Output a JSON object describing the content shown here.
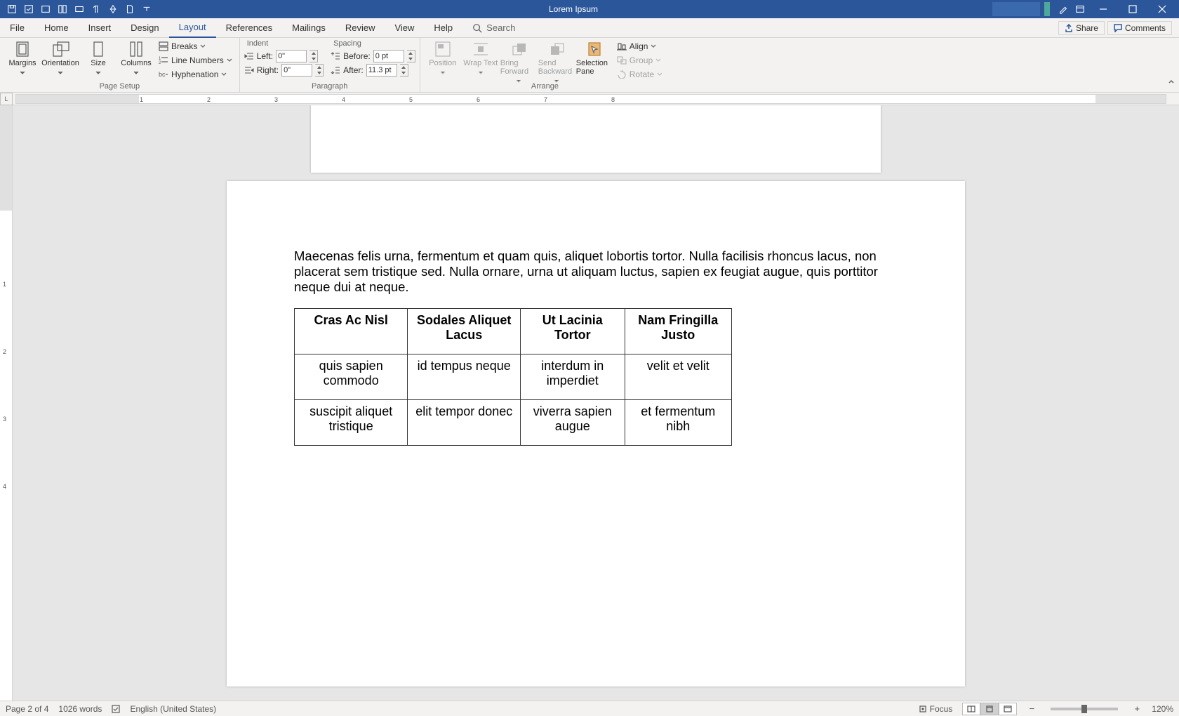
{
  "title": "Lorem Ipsum",
  "tabs": [
    "File",
    "Home",
    "Insert",
    "Design",
    "Layout",
    "References",
    "Mailings",
    "Review",
    "View",
    "Help"
  ],
  "active_tab": "Layout",
  "search_placeholder": "Search",
  "share_label": "Share",
  "comments_label": "Comments",
  "ribbon": {
    "page_setup": {
      "margins": "Margins",
      "orientation": "Orientation",
      "size": "Size",
      "columns": "Columns",
      "breaks": "Breaks",
      "line_numbers": "Line Numbers",
      "hyphenation": "Hyphenation",
      "label": "Page Setup"
    },
    "paragraph": {
      "indent_hdr": "Indent",
      "spacing_hdr": "Spacing",
      "left_label": "Left:",
      "right_label": "Right:",
      "before_label": "Before:",
      "after_label": "After:",
      "left_val": "0\"",
      "right_val": "0\"",
      "before_val": "0 pt",
      "after_val": "11.3 pt",
      "label": "Paragraph"
    },
    "arrange": {
      "position": "Position",
      "wrap_text": "Wrap Text",
      "bring_forward": "Bring Forward",
      "send_backward": "Send Backward",
      "selection_pane": "Selection Pane",
      "align": "Align",
      "group": "Group",
      "rotate": "Rotate",
      "label": "Arrange"
    }
  },
  "ruler_corner": "L",
  "ruler_marks": [
    "1",
    "2",
    "3",
    "4",
    "5",
    "6",
    "7",
    "8"
  ],
  "vruler_marks": [
    "1",
    "2",
    "3",
    "4"
  ],
  "document": {
    "paragraph": "Maecenas felis urna, fermentum et quam quis, aliquet lobortis tortor. Nulla facilisis rhoncus lacus, non placerat sem tristique sed. Nulla ornare, urna ut aliquam luctus, sapien ex feugiat augue, quis porttitor neque dui at neque.",
    "table": {
      "headers": [
        "Cras Ac Nisl",
        "Sodales Aliquet Lacus",
        "Ut Lacinia Tortor",
        "Nam Fringilla Justo"
      ],
      "rows": [
        [
          "quis sapien commodo",
          "id tempus neque",
          "interdum in imperdiet",
          "velit et velit"
        ],
        [
          "suscipit aliquet tristique",
          "elit tempor donec",
          "viverra sapien augue",
          "et fermentum nibh"
        ]
      ]
    }
  },
  "status": {
    "page": "Page 2 of 4",
    "words": "1026 words",
    "language": "English (United States)",
    "focus": "Focus",
    "zoom": "120%"
  }
}
